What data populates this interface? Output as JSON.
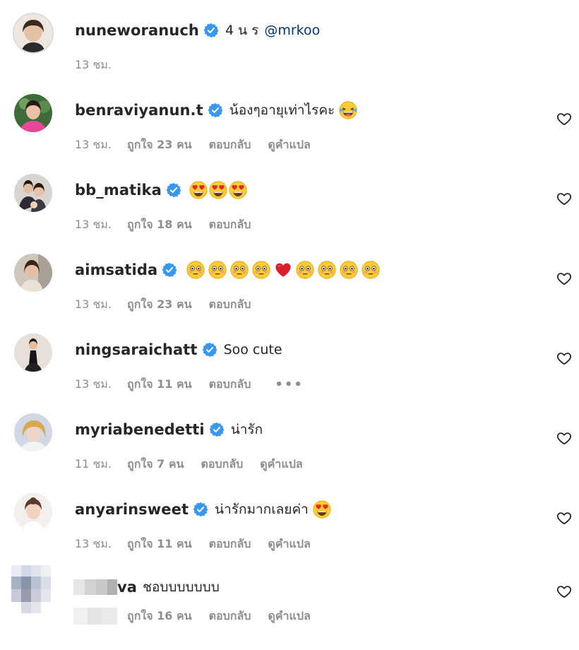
{
  "comments": [
    {
      "username": "nuneworanuch",
      "text": "4 น ร",
      "mention": "@mrkoo",
      "time": "13 ชม.",
      "likes": "",
      "reply": "",
      "translate": ""
    },
    {
      "username": "benraviyanun.t",
      "text": "น้องๆอายุเท่าไรคะ",
      "emoji": [
        "laughing-tears-emoji"
      ],
      "time": "13 ชม.",
      "likes": "ถูกใจ 23 คน",
      "reply": "ตอบกลับ",
      "translate": "ดูคำแปล"
    },
    {
      "username": "bb_matika",
      "text": "",
      "emoji": [
        "heart-eyes-emoji",
        "heart-eyes-emoji",
        "heart-eyes-emoji"
      ],
      "time": "13 ชม.",
      "likes": "ถูกใจ 18 คน",
      "reply": "ตอบกลับ",
      "translate": ""
    },
    {
      "username": "aimsatida",
      "text": "",
      "emoji": [
        "flushed-emoji",
        "flushed-emoji",
        "flushed-emoji",
        "flushed-emoji",
        "red-heart-emoji",
        "flushed-emoji",
        "flushed-emoji",
        "flushed-emoji",
        "flushed-emoji"
      ],
      "time": "13 ชม.",
      "likes": "ถูกใจ 23 คน",
      "reply": "ตอบกลับ",
      "translate": ""
    },
    {
      "username": "ningsaraichatt",
      "text": "Soo cute",
      "time": "13 ชม.",
      "likes": "ถูกใจ 11 คน",
      "reply": "ตอบกลับ",
      "more": "•••",
      "translate": ""
    },
    {
      "username": "myriabenedetti",
      "text": "น่ารัก",
      "time": "11 ชม.",
      "likes": "ถูกใจ 7 คน",
      "reply": "ตอบกลับ",
      "translate": "ดูคำแปล"
    },
    {
      "username": "anyarinsweet",
      "text": "น่ารักมากเลยค่า",
      "emoji": [
        "heart-eyes-emoji"
      ],
      "time": "13 ชม.",
      "likes": "ถูกใจ 11 คน",
      "reply": "ตอบกลับ",
      "translate": "ดูคำแปล"
    },
    {
      "username": "va",
      "text": "ชอบบบบบบบ",
      "time": "",
      "likes": "ถูกใจ 16 คน",
      "reply": "ตอบกลับ",
      "translate": "ดูคำแปล"
    }
  ],
  "colors": {
    "text": "#262626",
    "secondary": "#8e8e8e",
    "verified": "#3897f0",
    "mention": "#00376b",
    "background": "#ffffff"
  },
  "icons": {
    "verified": "verified-badge-icon",
    "like": "heart-outline-icon"
  }
}
